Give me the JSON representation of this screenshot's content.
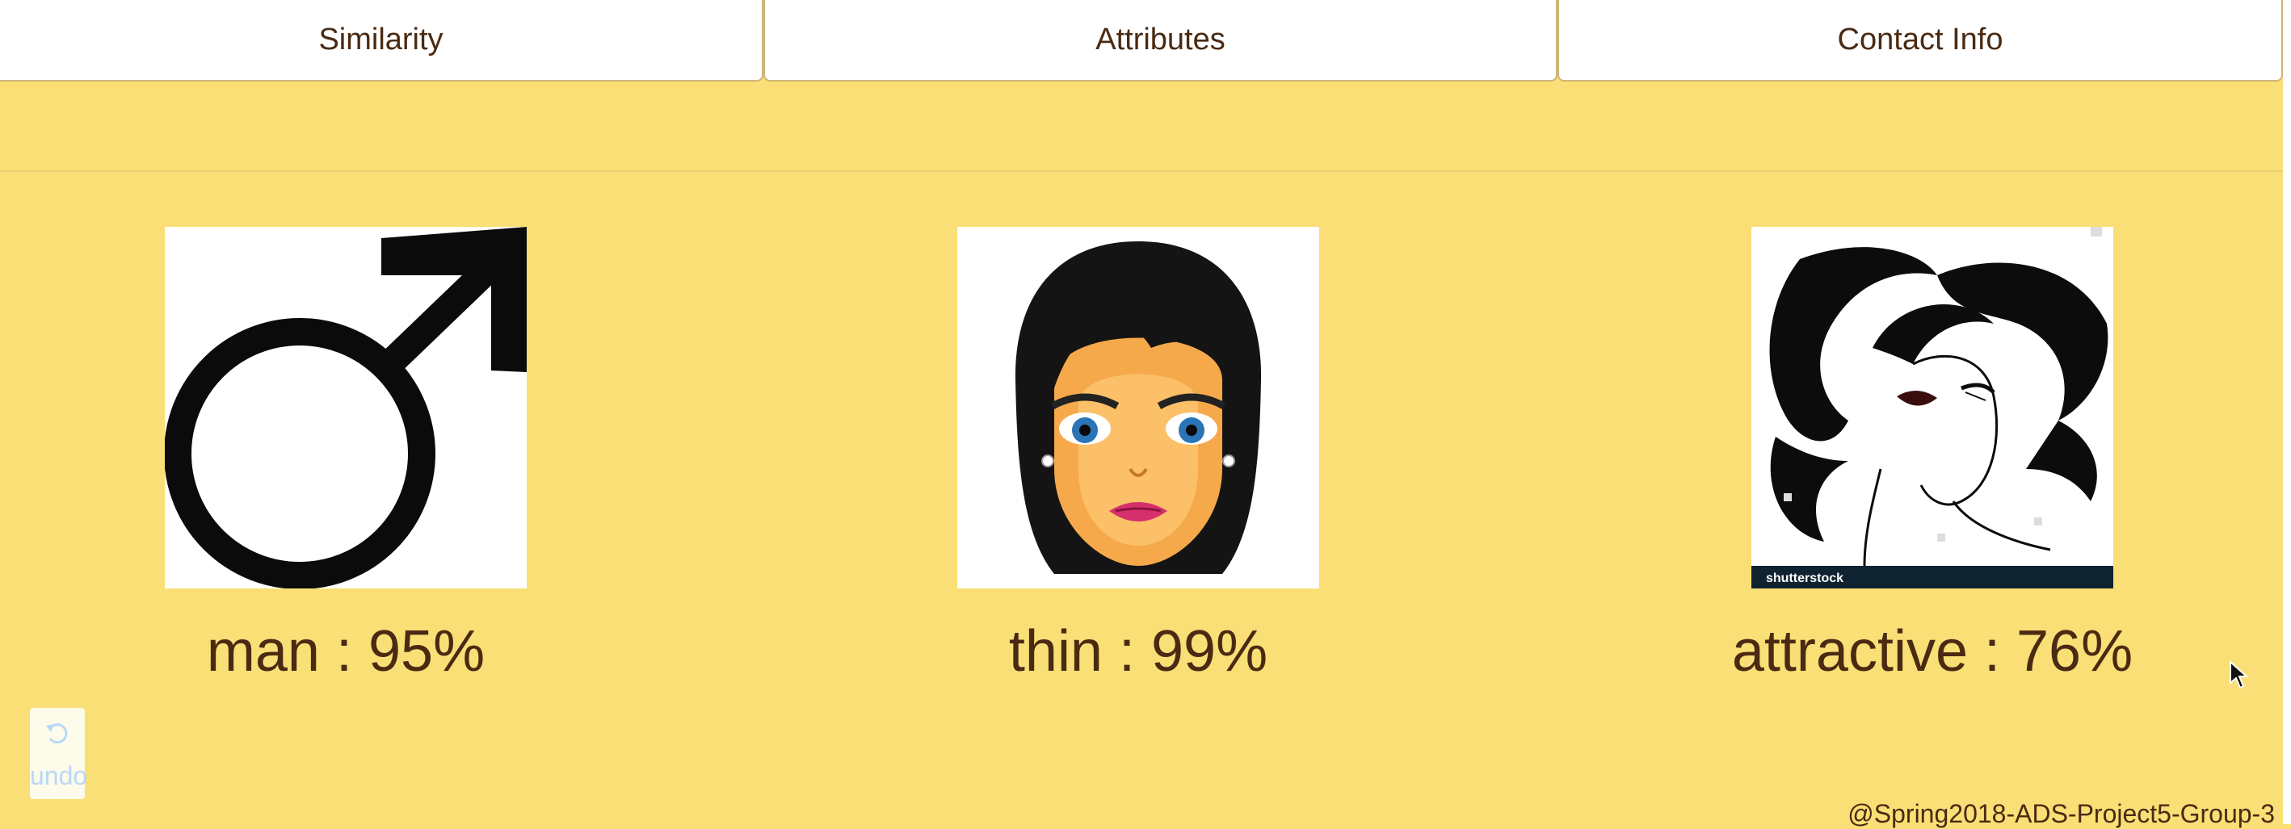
{
  "tabs": [
    {
      "label": "Similarity"
    },
    {
      "label": "Attributes"
    },
    {
      "label": "Contact Info"
    }
  ],
  "results": [
    {
      "label": "man : 95%",
      "icon": "male-symbol-icon"
    },
    {
      "label": "thin : 99%",
      "icon": "cartoon-woman-face-icon"
    },
    {
      "label": "attractive : 76%",
      "icon": "woman-portrait-illustration",
      "watermark": "shutterstock"
    }
  ],
  "undo": {
    "label": "undo",
    "icon": "undo-arrow-icon"
  },
  "footer": {
    "text": "@Spring2018-ADS-Project5-Group-3"
  },
  "colors": {
    "background": "#f9df75",
    "tab_background": "#ffffff",
    "text": "#4a2a12",
    "undo_label": "#b9d8f7"
  }
}
